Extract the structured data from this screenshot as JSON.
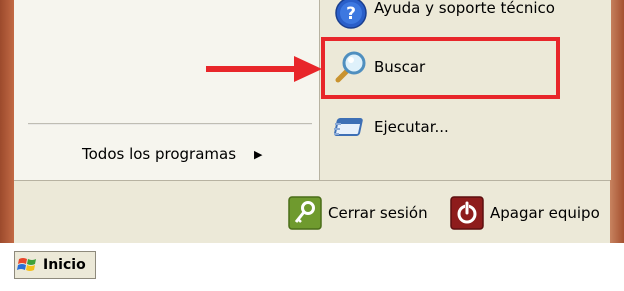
{
  "start_menu": {
    "all_programs_label": "Todos los programas",
    "all_programs_arrow": "▶",
    "right_pane": {
      "help_label": "Ayuda y soporte técnico",
      "search_label": "Buscar",
      "run_label": "Ejecutar..."
    },
    "footer": {
      "logoff_label": "Cerrar sesión",
      "shutdown_label": "Apagar equipo"
    }
  },
  "taskbar": {
    "start_label": "Inicio"
  },
  "annotation": {
    "highlight_color": "#e8262a"
  },
  "icons": {
    "help": "help-icon",
    "search": "magnifier-icon",
    "run": "run-icon",
    "logoff": "key-icon",
    "shutdown": "power-icon",
    "start": "windows-flag-icon"
  }
}
